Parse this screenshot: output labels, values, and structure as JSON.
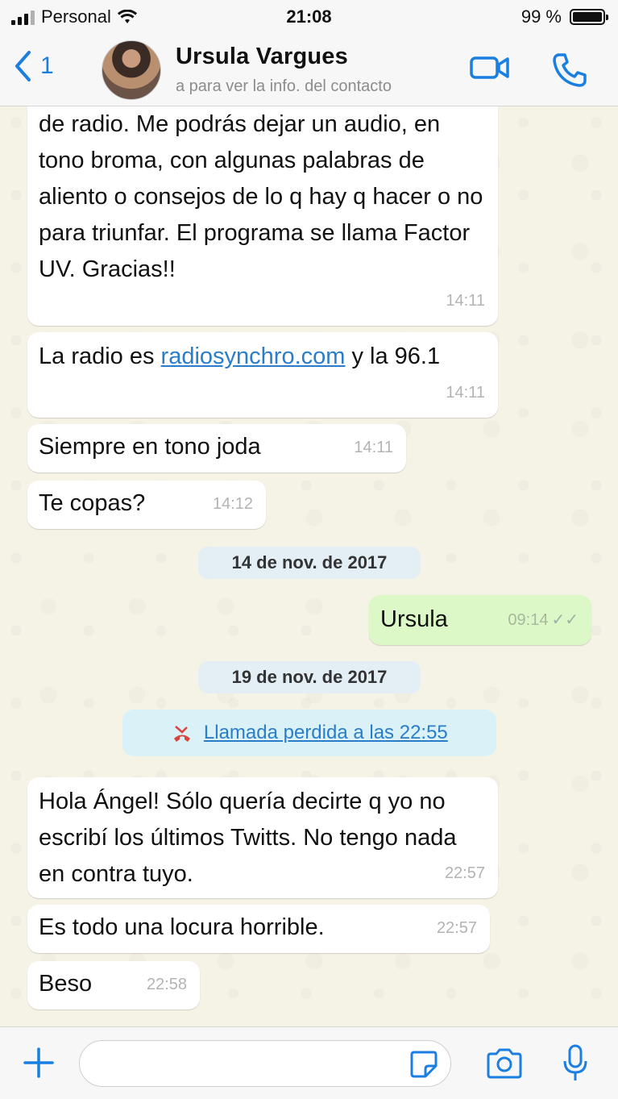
{
  "status_bar": {
    "carrier": "Personal",
    "time": "21:08",
    "battery": "99 %",
    "battery_level": 0.99
  },
  "header": {
    "back_count": "1",
    "contact_name": "Ursula Vargues",
    "subtitle": "a para ver la info. del contacto",
    "icons": [
      "chevron-left-icon",
      "video-call-icon",
      "phone-icon"
    ]
  },
  "messages": [
    {
      "text": "de radio. Me podrás dejar un audio, en tono broma, con algunas palabras de aliento o consejos de lo q hay q hacer o no para triunfar. El programa se llama Factor UV. Gracias!!",
      "time": "14:11"
    },
    {
      "text_before": "La radio es ",
      "link": "radiosynchro.com",
      "text_after": " y la 96.1",
      "time": "14:11"
    },
    {
      "text": "Siempre en tono joda",
      "time": "14:11"
    },
    {
      "text": "Te copas?",
      "time": "14:12"
    },
    {
      "text": "Ursula",
      "time": "09:14"
    },
    {
      "text": "Hola Ángel! Sólo quería decirte q yo no escribí los últimos Twitts. No tengo nada en contra tuyo.",
      "time": "22:57"
    },
    {
      "text": "Es todo una locura horrible.",
      "time": "22:57"
    },
    {
      "text": "Beso",
      "time": "22:58"
    }
  ],
  "dates": [
    "14 de nov. de 2017",
    "19 de nov. de 2017"
  ],
  "missed_call": {
    "label": "Llamada perdida a las 22:55",
    "icon": "missed-call-icon"
  },
  "input": {
    "placeholder": "",
    "icons": [
      "plus-icon",
      "sticker-icon",
      "camera-icon",
      "microphone-icon"
    ]
  },
  "colors": {
    "accent": "#1a7fe0",
    "outgoing_bubble": "#dcf8c6",
    "incoming_bubble": "#ffffff",
    "date_chip": "#e3eef5",
    "call_chip": "#d9f1f7"
  }
}
